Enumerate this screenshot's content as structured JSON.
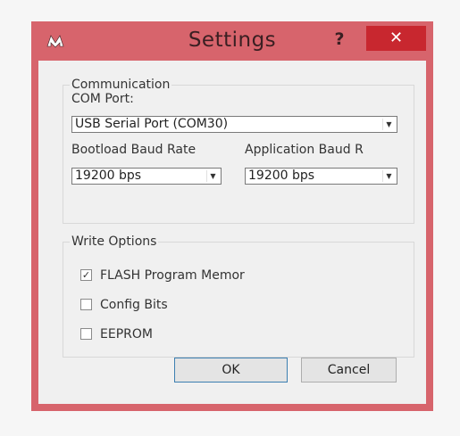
{
  "window": {
    "title": "Settings",
    "help_label": "?",
    "close_label": "✕"
  },
  "communication": {
    "group_title": "Communication",
    "com_port_label": "COM Port:",
    "com_port_value": "USB Serial Port (COM30)",
    "bootload_baud_label": "Bootload Baud Ratе",
    "bootload_baud_value": "19200 bps",
    "application_baud_label": "Application Baud R",
    "application_baud_value": "19200 bps"
  },
  "write_options": {
    "group_title": "Write Options",
    "items": [
      {
        "label": "FLASH Program Memor",
        "checked": true,
        "mark": "✓"
      },
      {
        "label": "Config Bits",
        "checked": false,
        "mark": ""
      },
      {
        "label": "EEPROM",
        "checked": false,
        "mark": ""
      }
    ]
  },
  "buttons": {
    "ok_label": "OK",
    "cancel_label": "Cancel"
  },
  "colors": {
    "frame": "#d7646c",
    "close_button": "#c8272f"
  },
  "icons": {
    "app": "microchip-logo-icon",
    "dropdown": "chevron-down-icon",
    "check": "checkmark-icon"
  }
}
